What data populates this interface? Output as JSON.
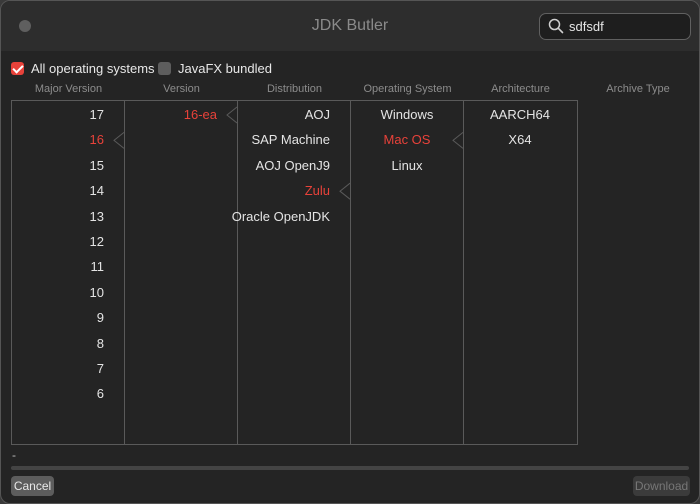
{
  "window": {
    "title": "JDK Butler"
  },
  "search": {
    "value": "sdfsdf"
  },
  "options": {
    "all_os_label": "All operating systems",
    "all_os_checked": true,
    "javafx_label": "JavaFX bundled",
    "javafx_checked": false
  },
  "columns": {
    "major_version": "Major Version",
    "version": "Version",
    "distribution": "Distribution",
    "operating_system": "Operating System",
    "architecture": "Architecture",
    "archive_type": "Archive Type"
  },
  "major_versions": [
    "17",
    "16",
    "15",
    "14",
    "13",
    "12",
    "11",
    "10",
    "9",
    "8",
    "7",
    "6"
  ],
  "selected_major_version": "16",
  "versions": [
    "16-ea"
  ],
  "selected_version": "16-ea",
  "distributions": [
    "AOJ",
    "SAP Machine",
    "AOJ OpenJ9",
    "Zulu",
    "Oracle OpenJDK"
  ],
  "selected_distribution": "Zulu",
  "operating_systems": [
    "Windows",
    "Mac OS",
    "Linux"
  ],
  "selected_operating_system": "Mac OS",
  "architectures": [
    "AARCH64",
    "X64"
  ],
  "status_text": "-",
  "progress": 0,
  "buttons": {
    "cancel": "Cancel",
    "download": "Download"
  },
  "colors": {
    "accent": "#e8423a",
    "background": "#242424",
    "titlebar": "#2d2d2d"
  }
}
